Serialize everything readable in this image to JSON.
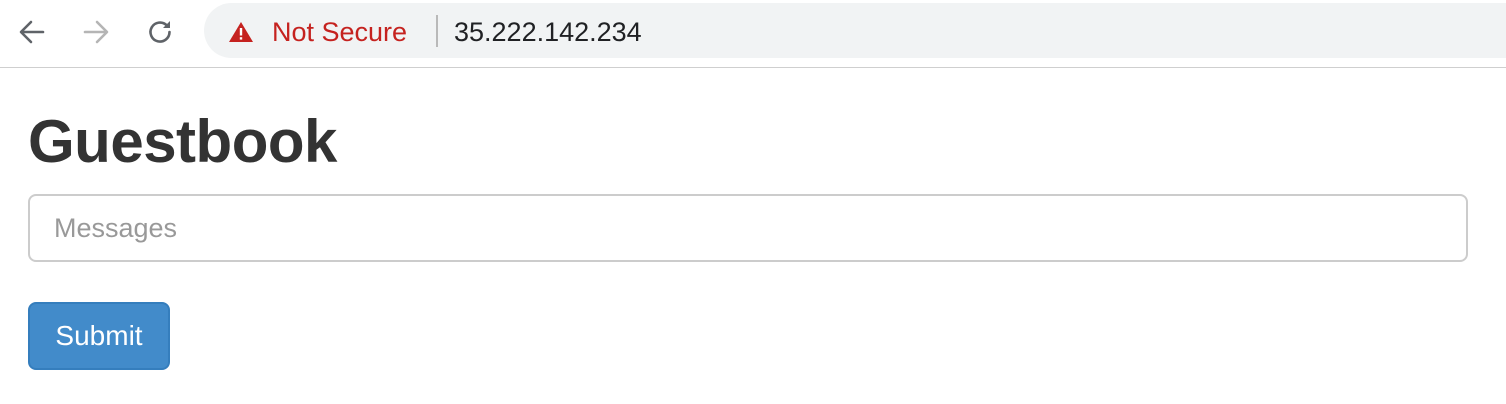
{
  "browser": {
    "nav": {
      "back_icon": "arrow-left-icon",
      "forward_icon": "arrow-right-icon",
      "reload_icon": "reload-icon"
    },
    "security": {
      "icon": "warning-triangle-icon",
      "label": "Not Secure",
      "color": "#c5221f"
    },
    "url": "35.222.142.234"
  },
  "page": {
    "title": "Guestbook",
    "messages_input": {
      "value": "",
      "placeholder": "Messages"
    },
    "submit_label": "Submit",
    "accent_color": "#428bca"
  }
}
